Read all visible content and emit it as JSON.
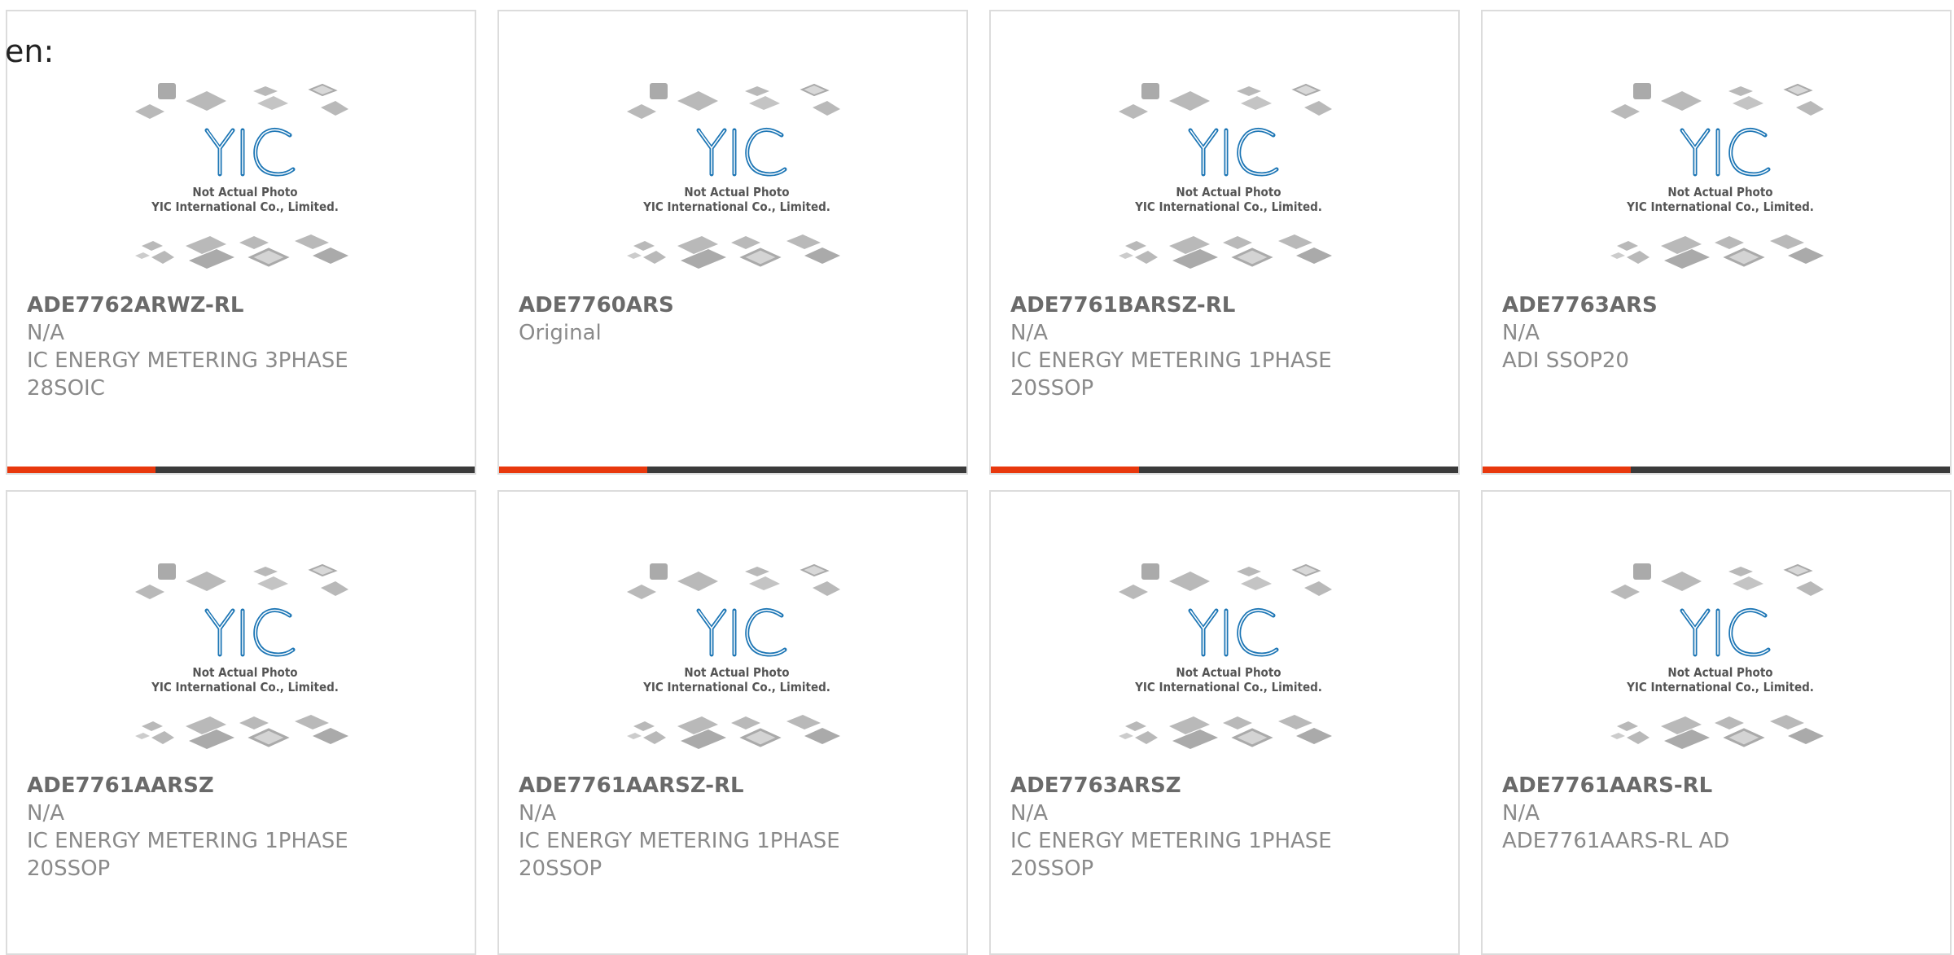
{
  "lang_label": "en:",
  "placeholder_image": {
    "caption_line1": "Not Actual Photo",
    "caption_line2": "YIC International Co., Limited.",
    "logo_text": "YIC",
    "logo_color": "#1d76b5",
    "chip_color": "#b9b9b9"
  },
  "accent_color": "#e8380d",
  "products": [
    {
      "part": "ADE7762ARWZ-RL",
      "lines": [
        "N/A",
        "IC ENERGY METERING 3PHASE",
        "28SOIC"
      ]
    },
    {
      "part": "ADE7760ARS",
      "lines": [
        "Original"
      ]
    },
    {
      "part": "ADE7761BARSZ-RL",
      "lines": [
        "N/A",
        "IC ENERGY METERING 1PHASE",
        "20SSOP"
      ]
    },
    {
      "part": "ADE7763ARS",
      "lines": [
        "N/A",
        "ADI SSOP20"
      ]
    },
    {
      "part": "ADE7761AARSZ",
      "lines": [
        "N/A",
        "IC ENERGY METERING 1PHASE",
        "20SSOP"
      ]
    },
    {
      "part": "ADE7761AARSZ-RL",
      "lines": [
        "N/A",
        "IC ENERGY METERING 1PHASE",
        "20SSOP"
      ]
    },
    {
      "part": "ADE7763ARSZ",
      "lines": [
        "N/A",
        "IC ENERGY METERING 1PHASE",
        "20SSOP"
      ]
    },
    {
      "part": "ADE7761AARS-RL",
      "lines": [
        "N/A",
        "ADE7761AARS-RL AD"
      ]
    }
  ]
}
